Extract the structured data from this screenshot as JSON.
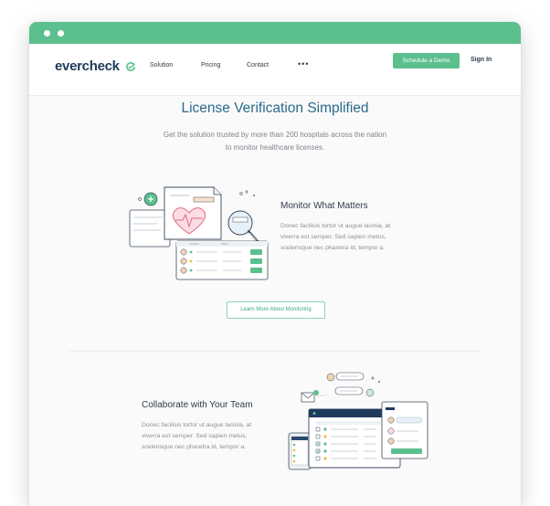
{
  "nav": {
    "logo": "evercheck",
    "links": [
      "Solution",
      "Pricing",
      "Contact"
    ],
    "more": "•••",
    "demo_button": "Schedule a Demo",
    "sign_in": "Sign In"
  },
  "hero": {
    "title": "License Verification Simplified",
    "subtitle": "Get the solution trusted by more than 200 hospitals across the nation to monitor healthcare licenses."
  },
  "features": [
    {
      "title": "Monitor What Matters",
      "description": "Donec facilisis tortor ut augue lacinia, at viverra est semper. Sed sapien metus, scelerisque nec pharetra id, tempor a.",
      "button": "Learn More About Monitoring"
    },
    {
      "title": "Collaborate with Your Team",
      "description": "Donec facilisis tortor ut augue lacinia, at viverra est semper. Sed sapien metus, scelerisque nec pharetra id, tempor a."
    }
  ],
  "colors": {
    "brand_green": "#5cc08e",
    "navy": "#1f3b5c",
    "title_blue": "#2b6a8c"
  },
  "icons": [
    "refresh-check-icon",
    "heart-document-icon",
    "magnifier-icon",
    "plus-icon",
    "avatar-icon",
    "envelope-icon",
    "monitor-icon",
    "phone-icon"
  ]
}
